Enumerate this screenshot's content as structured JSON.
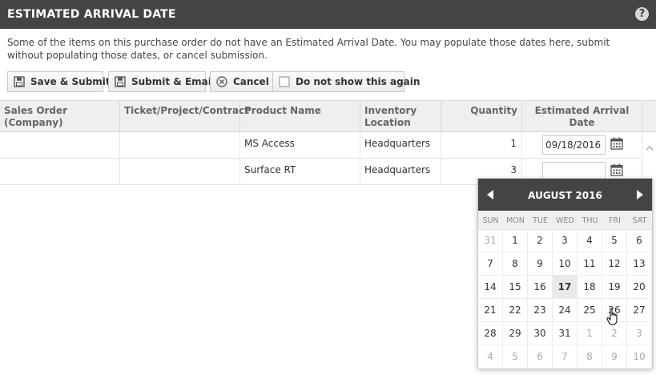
{
  "dialog": {
    "title": "ESTIMATED ARRIVAL DATE",
    "help_glyph": "?"
  },
  "intro_text": "Some of the items on this purchase order do not have an Estimated Arrival Date. You may populate those dates here, submit without populating those dates, or cancel submission.",
  "toolbar": {
    "save_submit": "Save & Submit",
    "submit_email": "Submit & Email",
    "cancel": "Cancel",
    "do_not_show": "Do not show this again"
  },
  "table": {
    "headers": {
      "sales_order": "Sales Order (Company)",
      "ticket": "Ticket/Project/Contract",
      "product": "Product Name",
      "inventory": "Inventory Location",
      "quantity": "Quantity",
      "eta": "Estimated Arrival Date"
    },
    "rows": [
      {
        "sales_order": "",
        "ticket": "",
        "product": "MS Access",
        "inventory": "Headquarters",
        "quantity": "1",
        "eta": "09/18/2016"
      },
      {
        "sales_order": "",
        "ticket": "",
        "product": "Surface RT",
        "inventory": "Headquarters",
        "quantity": "3",
        "eta": ""
      }
    ]
  },
  "calendar": {
    "title": "AUGUST 2016",
    "dows": [
      "SUN",
      "MON",
      "TUE",
      "WED",
      "THU",
      "FRI",
      "SAT"
    ],
    "weeks": [
      [
        "31",
        "1",
        "2",
        "3",
        "4",
        "5",
        "6"
      ],
      [
        "7",
        "8",
        "9",
        "10",
        "11",
        "12",
        "13"
      ],
      [
        "14",
        "15",
        "16",
        "17",
        "18",
        "19",
        "20"
      ],
      [
        "21",
        "22",
        "23",
        "24",
        "25",
        "26",
        "27"
      ],
      [
        "28",
        "29",
        "30",
        "31",
        "1",
        "2",
        "3"
      ],
      [
        "4",
        "5",
        "6",
        "7",
        "8",
        "9",
        "10"
      ]
    ],
    "today": "17"
  },
  "colors": {
    "header_bg": "#444444",
    "grid_header_bg": "#efefef"
  },
  "icons": [
    "help-icon",
    "save-icon",
    "email-icon",
    "cancel-icon",
    "checkbox-icon",
    "calendar-icon",
    "chevron-left-icon",
    "chevron-right-icon",
    "chevron-up-icon",
    "hand-cursor-icon"
  ]
}
